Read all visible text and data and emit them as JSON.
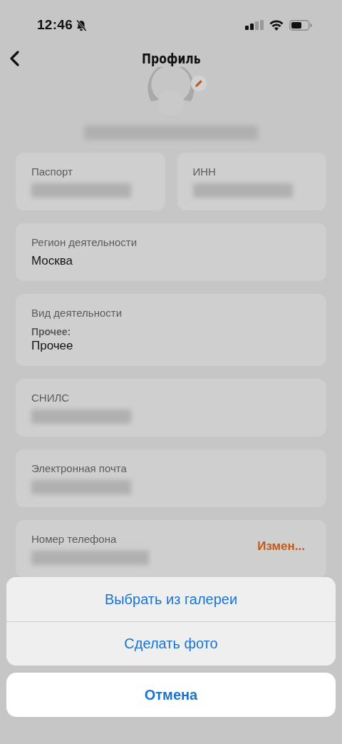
{
  "status_bar": {
    "time": "12:46",
    "silent": true
  },
  "header": {
    "title": "Профиль"
  },
  "rows": [
    {
      "cards": [
        {
          "label": "Паспорт",
          "kind": "blurred"
        },
        {
          "label": "ИНН",
          "kind": "blurred"
        }
      ]
    },
    {
      "cards": [
        {
          "label": "Регион деятельности",
          "kind": "text",
          "value": "Москва"
        }
      ]
    },
    {
      "cards": [
        {
          "label": "Вид деятельности",
          "kind": "text",
          "sublabel": "Прочее:",
          "value": "Прочее"
        }
      ]
    },
    {
      "cards": [
        {
          "label": "СНИЛС",
          "kind": "blurred"
        }
      ]
    },
    {
      "cards": [
        {
          "label": "Электронная почта",
          "kind": "blurred"
        }
      ]
    },
    {
      "cards": [
        {
          "label": "Номер телефона",
          "kind": "blurred",
          "action": "Измен..."
        }
      ]
    }
  ],
  "action_sheet": {
    "options": [
      "Выбрать из галереи",
      "Сделать фото"
    ],
    "cancel": "Отмена"
  }
}
